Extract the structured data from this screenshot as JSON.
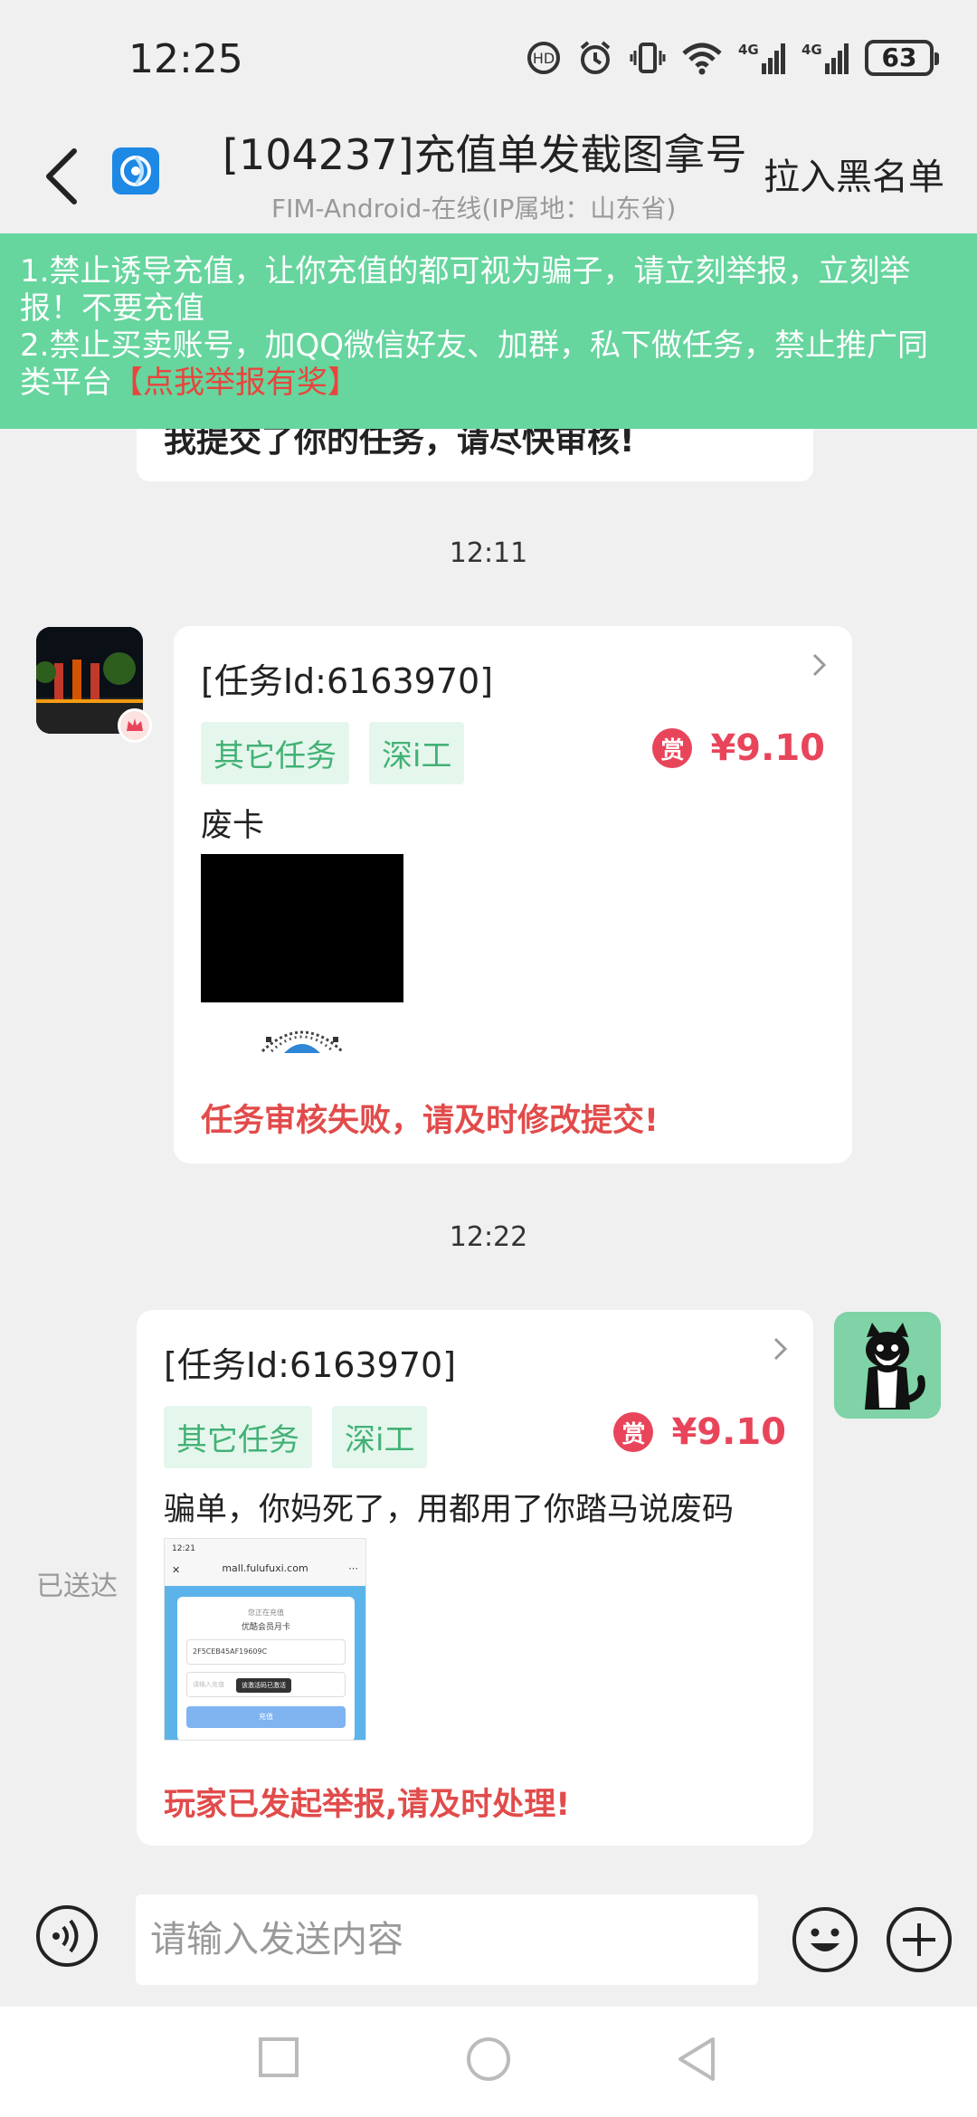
{
  "status_bar": {
    "time": "12:25",
    "network_1": "4G",
    "network_2": "4G",
    "battery": "63"
  },
  "header": {
    "title": "[104237]充值单发截图拿号",
    "subtitle": "FIM-Android-在线(IP属地：山东省)",
    "blacklist_label": "拉入黑名单"
  },
  "notice": {
    "line1": "1.禁止诱导充值，让你充值的都可视为骗子，请立刻举报，立刻举报！不要充值",
    "line2_prefix": "2.禁止买卖账号，加QQ微信好友、加群，私下做任务，禁止推广同类平台",
    "line2_link": "【点我举报有奖】",
    "background": "#66d59e",
    "link_color": "#e8453c"
  },
  "messages": {
    "prev_text": "我提交了你的任务，请尽快审核!",
    "time_1": "12:11",
    "card_1": {
      "title": "[任务Id:6163970]",
      "tags": [
        "其它任务",
        "深i工"
      ],
      "reward_icon": "赏",
      "reward": "¥9.10",
      "text": "废卡",
      "status": "任务审核失败，请及时修改提交!"
    },
    "time_2": "12:22",
    "card_2": {
      "title": "[任务Id:6163970]",
      "tags": [
        "其它任务",
        "深i工"
      ],
      "reward_icon": "赏",
      "reward": "¥9.10",
      "text": "骗单，你妈死了，用都用了你踏马说废码",
      "status": "玩家已发起举报,请及时处理!",
      "thumbnail": {
        "time": "12:21",
        "url": "mall.fulufuxi.com",
        "line1": "您正在充值",
        "line2": "优酷会员月卡",
        "code": "2F5CEB45AF19609C",
        "placeholder": "请输入充值",
        "toast": "该激活码已激活",
        "button": "充值"
      }
    },
    "delivered": "已送达"
  },
  "input": {
    "placeholder": "请输入发送内容"
  },
  "colors": {
    "accent_green": "#43b176",
    "tag_bg": "#e5f7ec",
    "reward_red": "#e8455b",
    "status_red": "#e24b4b"
  }
}
